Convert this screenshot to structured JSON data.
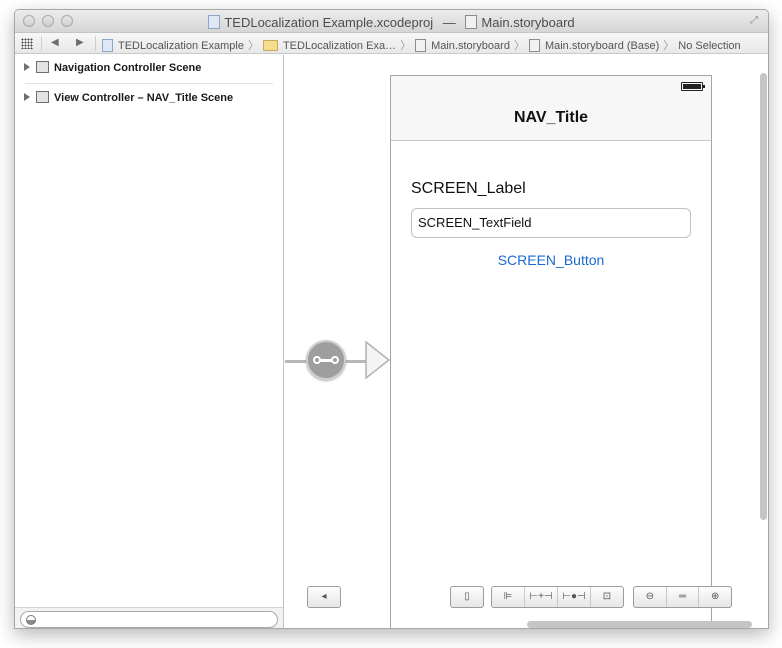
{
  "window": {
    "title_project": "TEDLocalization Example.xcodeproj",
    "title_separator": "—",
    "title_file": "Main.storyboard"
  },
  "jumpbar": {
    "crumbs": [
      {
        "label": "TEDLocalization Example",
        "icon": "project-icon"
      },
      {
        "label": "TEDLocalization Exa…",
        "icon": "folder-icon"
      },
      {
        "label": "Main.storyboard",
        "icon": "storyboard-icon"
      },
      {
        "label": "Main.storyboard (Base)",
        "icon": "storyboard-icon"
      },
      {
        "label": "No Selection",
        "icon": ""
      }
    ],
    "back_glyph": "◀",
    "forward_glyph": "▶",
    "chevron": "〉"
  },
  "outline": {
    "scenes": [
      {
        "label": "Navigation Controller Scene"
      },
      {
        "label": "View Controller – NAV_Title Scene"
      }
    ]
  },
  "scene": {
    "nav_title": "NAV_Title",
    "label_text": "SCREEN_Label",
    "textfield_text": "SCREEN_TextField",
    "button_text": "SCREEN_Button"
  },
  "colors": {
    "button_blue": "#1a6ad1",
    "segue_gray": "#9e9e9e"
  },
  "canvas_toolbar": {
    "toggle_outline": "◂",
    "size_class": "▯",
    "align": "⊫",
    "pin": "⊢+⊣",
    "resolve": "⊢●⊣",
    "resizing": "⊡",
    "zoom_out": "⊖",
    "zoom_actual": "═",
    "zoom_in": "⊕"
  }
}
